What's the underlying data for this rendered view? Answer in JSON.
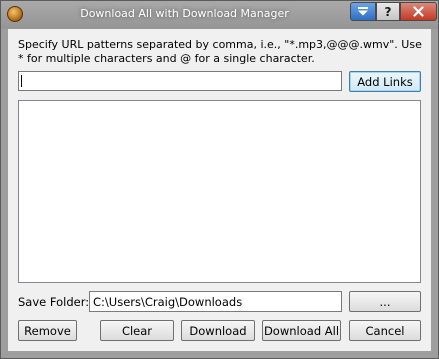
{
  "window": {
    "title": "Download All with Download Manager",
    "help_label": "?",
    "close_label": "✕"
  },
  "instructions": "Specify URL patterns separated by comma, i.e., \"*.mp3,@@@.wmv\". Use * for multiple characters and @ for a single character.",
  "url_input": {
    "value": ""
  },
  "add_links_label": "Add Links",
  "links_list": {
    "items": []
  },
  "save_folder": {
    "label": "Save Folder:",
    "value": "C:\\Users\\Craig\\Downloads",
    "browse_label": "..."
  },
  "buttons": {
    "remove": "Remove",
    "clear": "Clear",
    "download": "Download",
    "download_all": "Download All",
    "cancel": "Cancel"
  },
  "icons": {
    "app": "download-manager-app-icon",
    "menu": "dropdown-arrow-icon",
    "help": "help-icon",
    "close": "close-icon"
  }
}
